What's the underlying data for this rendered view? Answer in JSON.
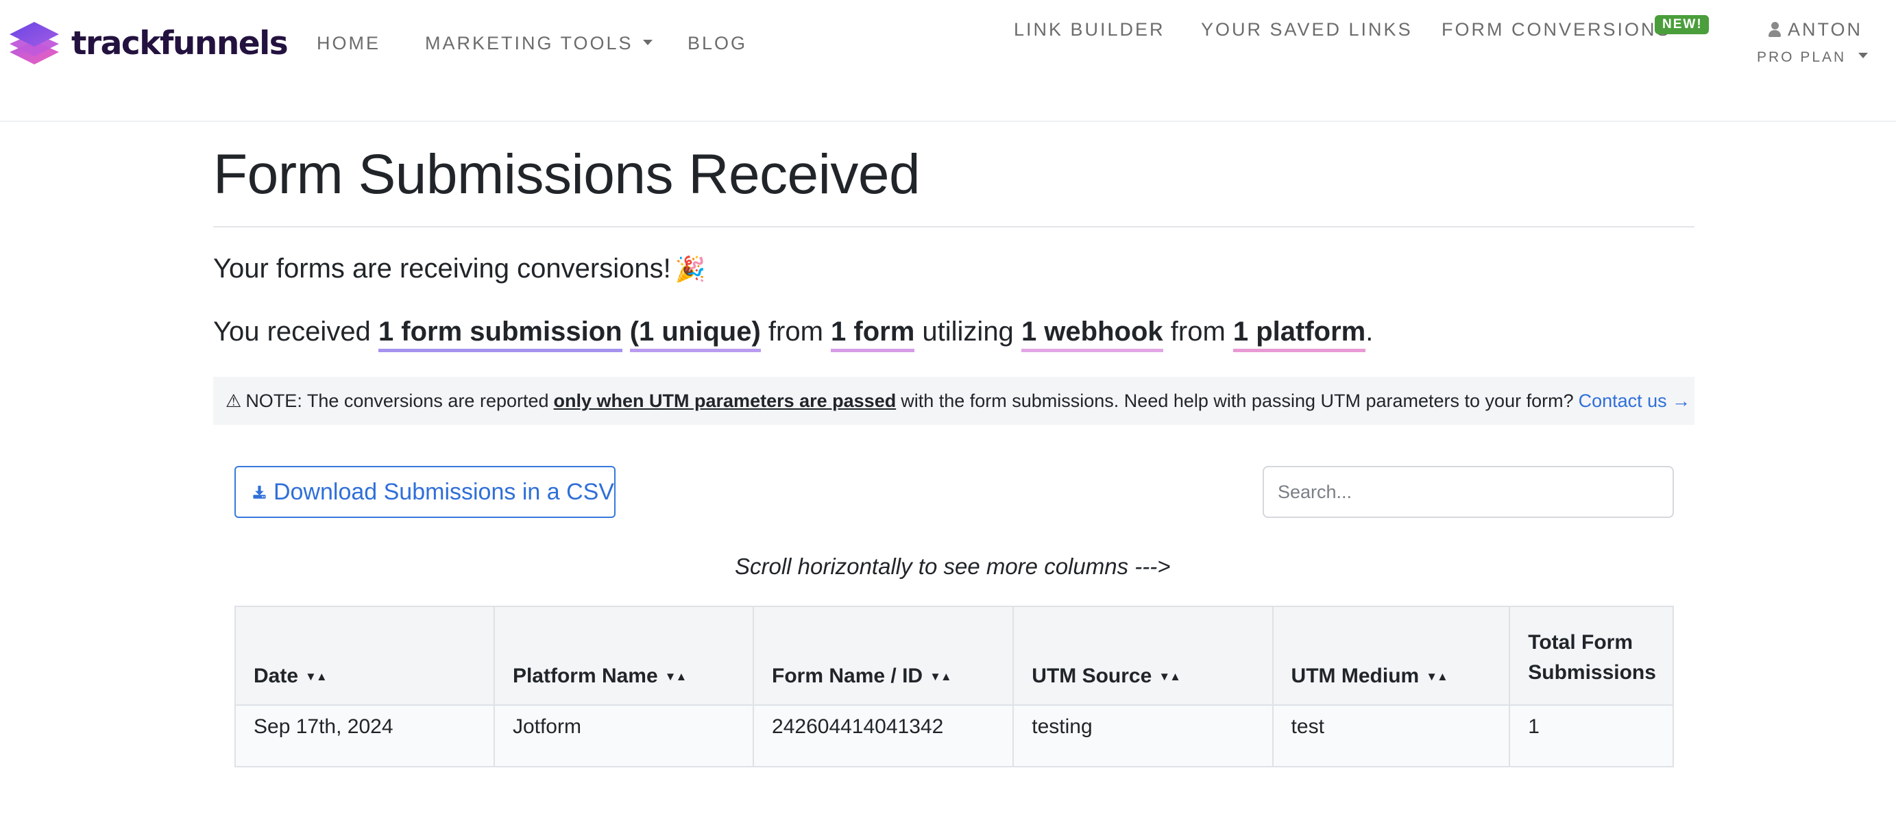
{
  "brand": {
    "name": "trackfunnels"
  },
  "nav": {
    "home": "HOME",
    "marketing_tools": "MARKETING TOOLS",
    "blog": "BLOG",
    "link_builder": "LINK BUILDER",
    "saved_links": "YOUR SAVED LINKS",
    "form_conversions": "FORM CONVERSIONS",
    "new_badge": "NEW!",
    "user_name": "ANTON",
    "plan": "PRO PLAN"
  },
  "page": {
    "title": "Form Submissions Received",
    "intro": "Your forms are receiving conversions!",
    "intro_emoji": "🎉",
    "summary": {
      "p1": "You received",
      "submissions": "1 form submission",
      "unique": "(1 unique)",
      "p2": "from",
      "forms": "1 form",
      "p3": "utilizing",
      "webhooks": "1 webhook",
      "p4": "from",
      "platforms": "1 platform",
      "end": "."
    },
    "note": {
      "icon": "⚠",
      "prefix": "NOTE: The conversions are reported",
      "emphasis": "only when UTM parameters are passed",
      "suffix": "with the form submissions. Need help with passing UTM parameters to your form?",
      "link": "Contact us →"
    },
    "download_button": "Download Submissions in a CSV",
    "search_placeholder": "Search...",
    "scroll_hint": "Scroll horizontally to see more columns --->"
  },
  "table": {
    "sort_glyph": "▼▲",
    "headers": [
      "Date",
      "Platform Name",
      "Form Name / ID",
      "UTM Source",
      "UTM Medium",
      "Total Form Submissions"
    ],
    "total_header_line1": "Total Form",
    "total_header_line2": "Submissions",
    "rows": [
      [
        "Sep 17th, 2024",
        "Jotform",
        "242604414041342",
        "testing",
        "test",
        "1"
      ]
    ]
  },
  "colors": {
    "brand_dark": "#23123f",
    "link_blue": "#2f6fd8",
    "badge_green": "#4a9e3b",
    "logo_purple": "#7b4ce6",
    "logo_pink": "#e45bc7"
  }
}
